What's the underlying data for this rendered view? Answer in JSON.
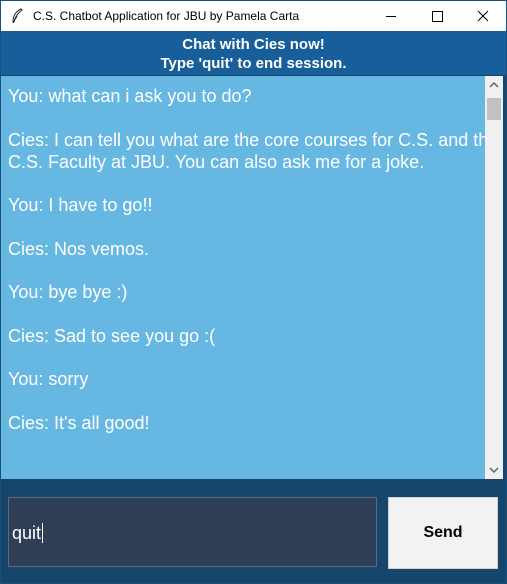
{
  "window": {
    "title": "C.S. Chatbot Application for JBU by Pamela Carta"
  },
  "header": {
    "line1": "Chat with Cies now!",
    "line2": "Type 'quit' to end session."
  },
  "chat": {
    "messages": [
      "You: what can i ask you to do?",
      "Cies: I can tell you what are the core courses for C.S. and the C.S. Faculty at JBU. You can also ask me for a joke.",
      "You: I have to go!!",
      "Cies: Nos vemos.",
      "You: bye bye :)",
      "Cies: Sad to see you go :(",
      "You: sorry",
      "Cies: It's all good!"
    ]
  },
  "input": {
    "value": "quit"
  },
  "send_button": {
    "label": "Send"
  },
  "colors": {
    "header_bg": "#175e9a",
    "chat_bg": "#66b8e3",
    "frame_bg": "#17466d",
    "entry_bg": "#2f3e55",
    "button_bg": "#f2f2f2"
  },
  "icons": {
    "app": "feather-icon",
    "minimize": "minimize-icon",
    "maximize": "maximize-icon",
    "close": "close-icon"
  }
}
